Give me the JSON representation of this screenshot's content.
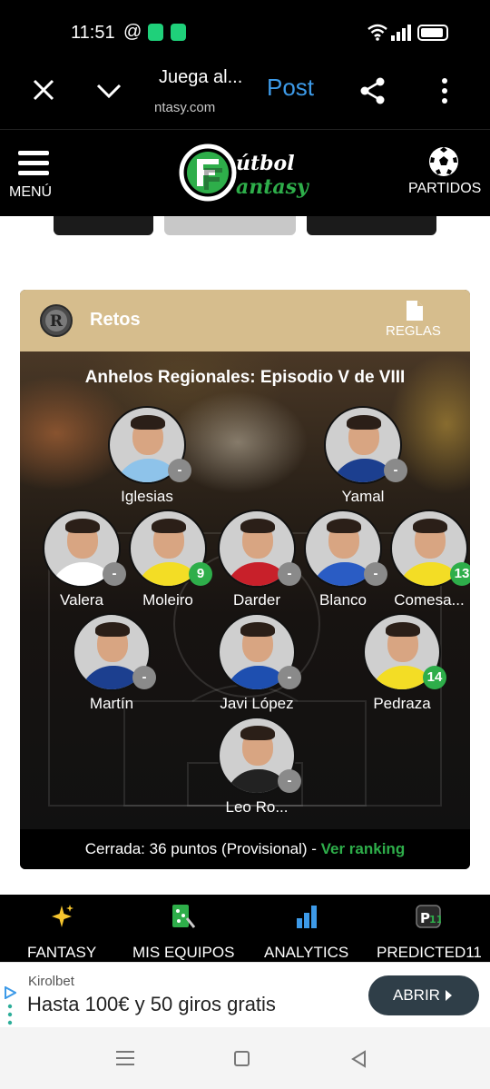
{
  "status_bar": {
    "time": "11:51",
    "at_symbol": "@",
    "notification_icons": [
      "battery-saver-icon",
      "shield-icon"
    ],
    "right_icons": [
      "wifi-icon",
      "signal-icon",
      "battery-icon"
    ]
  },
  "browser_bar": {
    "page_title": "Juega al...",
    "url": "ntasy.com",
    "post_label": "Post",
    "colors": {
      "post": "#3d9ae8"
    }
  },
  "site_header": {
    "menu_label": "MENÚ",
    "logo_text": "FútbolFantasy",
    "matches_label": "PARTIDOS"
  },
  "card": {
    "title": "Retos",
    "rules_label": "REGLAS",
    "match_title": "Anhelos Regionales: Episodio V de VIII",
    "players": [
      {
        "name": "Iglesias",
        "score": "-",
        "shirt": "#8ec3ea"
      },
      {
        "name": "Yamal",
        "score": "-",
        "shirt": "#1c3f8f"
      },
      {
        "name": "Valera",
        "score": "-",
        "shirt": "#ffffff"
      },
      {
        "name": "Moleiro",
        "score": "9",
        "shirt": "#f3dd25"
      },
      {
        "name": "Darder",
        "score": "-",
        "shirt": "#c8202a"
      },
      {
        "name": "Blanco",
        "score": "-",
        "shirt": "#2a5cc4"
      },
      {
        "name": "Comesa...",
        "score": "13",
        "shirt": "#f3dd25"
      },
      {
        "name": "Martín",
        "score": "-",
        "shirt": "#1c3f8f"
      },
      {
        "name": "Javi López",
        "score": "-",
        "shirt": "#1e4fb0"
      },
      {
        "name": "Pedraza",
        "score": "14",
        "shirt": "#f3dd25"
      },
      {
        "name": "Leo Ro...",
        "score": "-",
        "shirt": "#222222"
      }
    ],
    "footer_status": "Cerrada: 36 puntos (Provisional) - ",
    "footer_link": "Ver ranking",
    "colors": {
      "header": "#d6bd8d",
      "positive_score": "#2eae4a",
      "neutral_score": "#8a8a8a",
      "link": "#2eae4a"
    }
  },
  "bottom_nav": {
    "items": [
      {
        "label": "FANTASY",
        "icon": "sparkles-icon"
      },
      {
        "label": "MIS EQUIPOS",
        "icon": "lineup-board-icon"
      },
      {
        "label": "ANALYTICS",
        "icon": "bar-chart-icon"
      },
      {
        "label": "PREDICTED11",
        "icon": "predicted11-icon"
      }
    ]
  },
  "ad": {
    "brand": "Kirolbet",
    "headline": "Hasta 100€ y 50 giros gratis",
    "cta_label": "ABRIR"
  }
}
